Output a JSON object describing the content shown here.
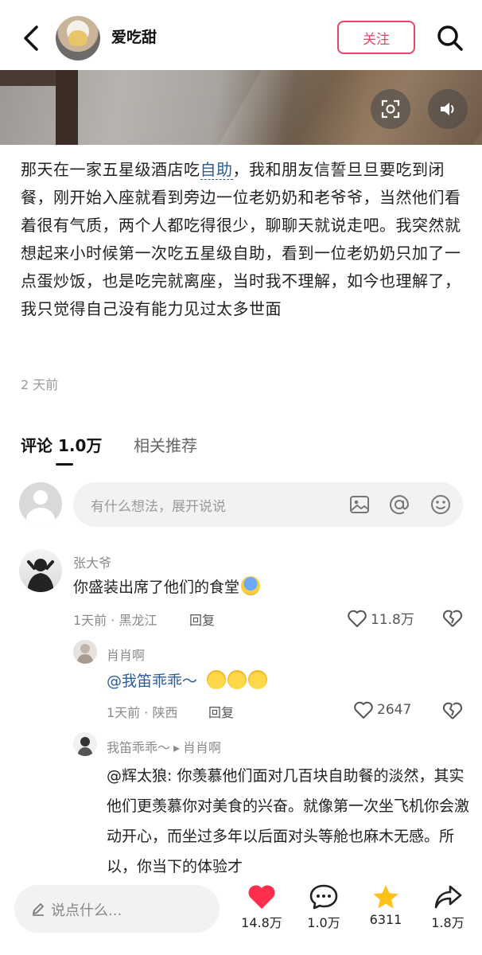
{
  "header": {
    "username": "爱吃甜",
    "follow_label": "关注"
  },
  "post": {
    "text_before_link": "那天在一家五星级酒店吃",
    "link_text": "自助",
    "text_after_link": "，我和朋友信誓旦旦要吃到闭餐，刚开始入座就看到旁边一位老奶奶和老爷爷，当然他们看着很有气质，两个人都吃得很少，聊聊天就说走吧。我突然就想起来小时候第一次吃五星级自助，看到一位老奶奶只加了一点蛋炒饭，也是吃完就离座，当时我不理解，如今也理解了，我只觉得自己没有能力见过太多世面",
    "time": "2 天前"
  },
  "tabs": {
    "comments": "评论 1.0万",
    "related": "相关推荐"
  },
  "comment_input": {
    "placeholder": "有什么想法，展开说说"
  },
  "comments": [
    {
      "author": "张大爷",
      "text": "你盛装出席了他们的食堂",
      "meta": "1天前 · 黑龙江",
      "reply_label": "回复",
      "likes": "11.8万"
    },
    {
      "author": "肖肖啊",
      "text": "@我笛乖乖～",
      "meta": "1天前 · 陕西",
      "reply_label": "回复",
      "likes": "2647"
    },
    {
      "author": "我笛乖乖～",
      "reply_to": "肖肖啊",
      "text": "@辉太狼: 你羡慕他们面对几百块自助餐的淡然，其实他们更羡慕你对美食的兴奋。就像第一次坐飞机你会激动开心，而坐过多年以后面对头等舱也麻木无感。所以，你当下的体验才"
    }
  ],
  "bottom_bar": {
    "placeholder": "说点什么...",
    "likes": "14.8万",
    "comments": "1.0万",
    "favorites": "6311",
    "shares": "1.8万"
  },
  "colors": {
    "accent": "#e8456a",
    "link": "#2d5d97",
    "like_heart": "#ff2e4d",
    "star": "#ffc21a"
  }
}
